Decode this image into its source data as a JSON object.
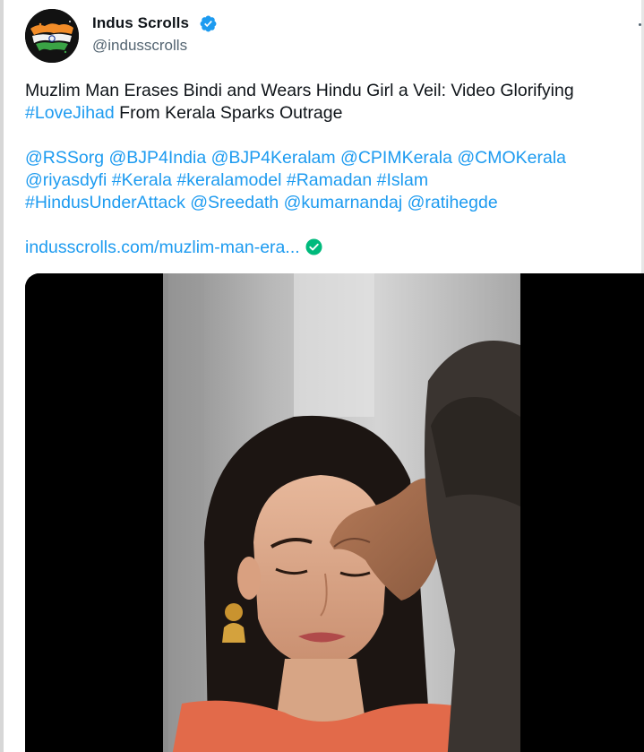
{
  "account": {
    "display_name": "Indus Scrolls",
    "handle": "@indusscrolls",
    "verified_icon": "verified-badge-icon",
    "avatar_icon": "india-flag-avatar"
  },
  "tweet": {
    "line1": "Muzlim Man Erases Bindi and Wears Hindu Girl a Veil: Video Glorifying",
    "hashtag_lovejihad": "#LoveJihad",
    "line2_rest": " From Kerala Sparks Outrage",
    "mentions_line1": "@RSSorg @BJP4India @BJP4Keralam @CPIMKerala @CMOKerala",
    "mentions_line2": "@riyasdyfi #Kerala #keralamodel #Ramadan #Islam",
    "mentions_line3": "#HindusUnderAttack @Sreedath @kumarnandaj @ratihegde",
    "link_text": "indusscrolls.com/muzlim-man-era...",
    "link_icon": "check-circle-icon"
  },
  "colors": {
    "text": "#0f1419",
    "secondary": "#536471",
    "link": "#1d9bf0",
    "verified": "#1d9bf0",
    "link_check": "#00ba7c"
  }
}
